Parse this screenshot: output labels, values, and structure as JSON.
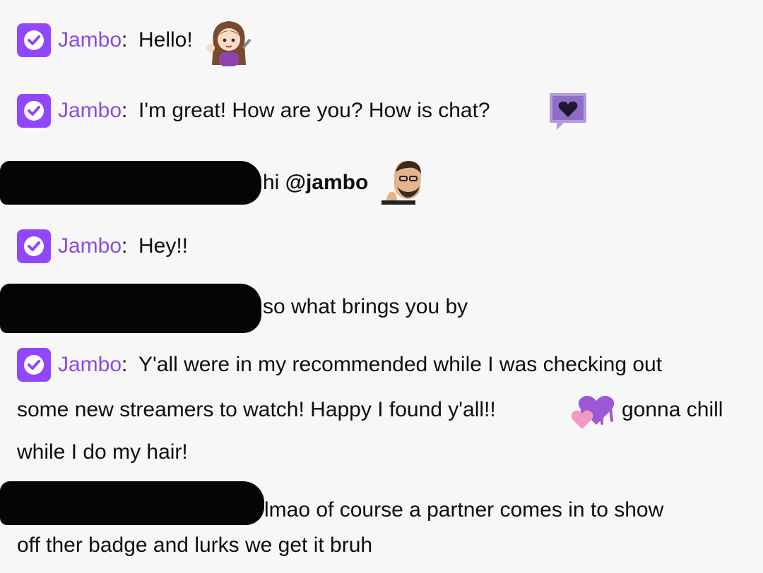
{
  "chat": {
    "messages": [
      {
        "user": "Jambo",
        "text": "Hello!",
        "emote": "waving-girl-emote"
      },
      {
        "user": "Jambo",
        "text": "I'm great! How are you? How is chat?",
        "emote": "purple-heart-speech-emote"
      },
      {
        "user": "",
        "redacted": true,
        "text": "hi ",
        "mention": "@jambo",
        "emote": "thinking-man-emote"
      },
      {
        "user": "Jambo",
        "text": "Hey!!"
      },
      {
        "user": "",
        "redacted": true,
        "text": "so what brings you by"
      },
      {
        "user": "Jambo",
        "text_line1": "Y'all were in my recommended while I was checking out",
        "text_line2a": "some new streamers to watch! Happy I found y'all!!",
        "text_line2b": "gonna chill",
        "text_line3": "while I do my hair!",
        "emote": "melting-hearts-emote"
      },
      {
        "user": "",
        "redacted": true,
        "text_line1": "lmao of course a partner comes in to show",
        "text_line2": "off ther badge and lurks we get it bruh"
      }
    ],
    "colon": ":",
    "badge_name": "verified-partner-badge",
    "colors": {
      "username": "#8c4be0",
      "badge": "#9147ff",
      "background": "#f7f7f8",
      "text": "#0e0e10"
    }
  }
}
